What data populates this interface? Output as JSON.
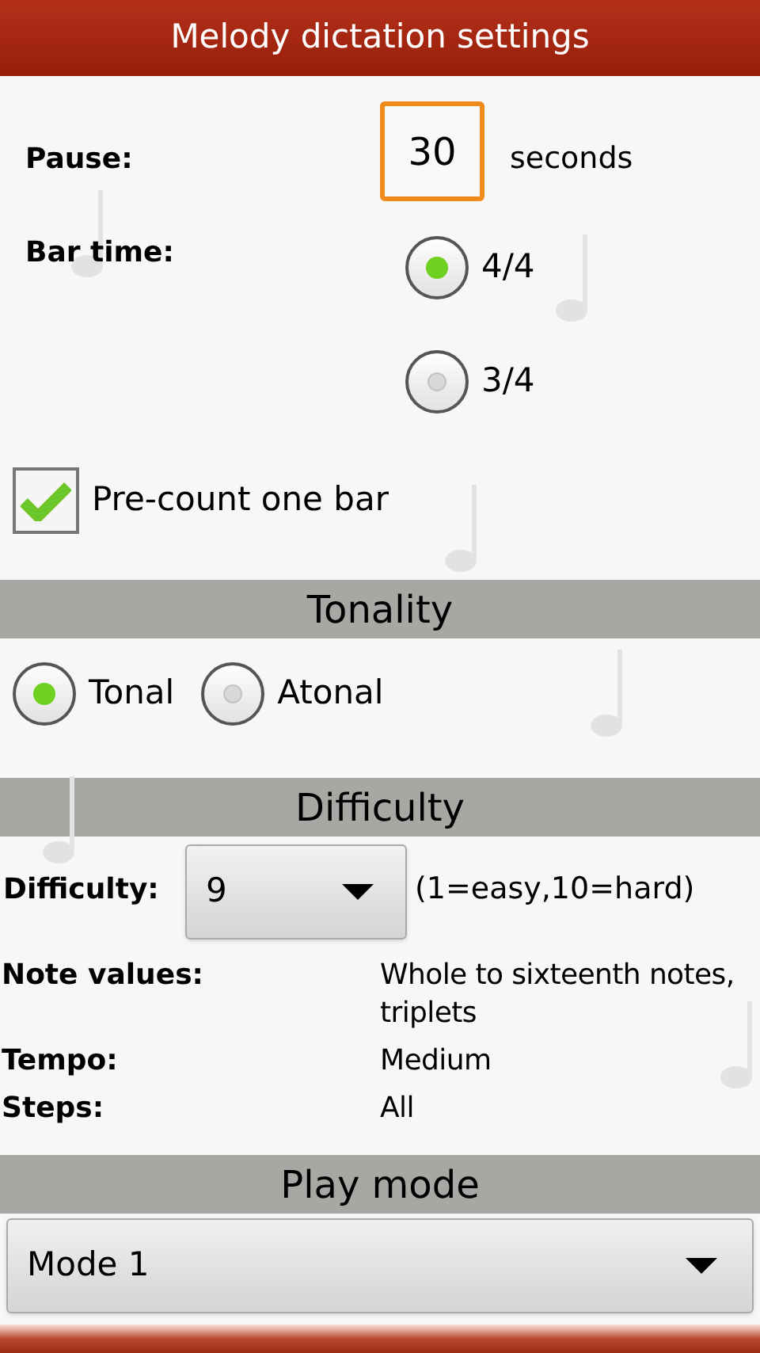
{
  "window": {
    "title": "Melody dictation settings"
  },
  "pause": {
    "label": "Pause:",
    "value": "30",
    "unit": "seconds"
  },
  "bar_time": {
    "label": "Bar time:",
    "options": [
      {
        "label": "4/4",
        "selected": true
      },
      {
        "label": "3/4",
        "selected": false
      }
    ]
  },
  "pre_count": {
    "label": "Pre-count one bar",
    "checked": true
  },
  "tonality": {
    "heading": "Tonality",
    "options": [
      {
        "label": "Tonal",
        "selected": true
      },
      {
        "label": "Atonal",
        "selected": false
      }
    ]
  },
  "difficulty": {
    "heading": "Difficulty",
    "label": "Difficulty:",
    "value": "9",
    "hint": "(1=easy,10=hard)",
    "details": [
      {
        "label": "Note values:",
        "value": "Whole to sixteenth notes, triplets"
      },
      {
        "label": "Tempo:",
        "value": "Medium"
      },
      {
        "label": "Steps:",
        "value": "All"
      }
    ]
  },
  "play_mode": {
    "heading": "Play mode",
    "value": "Mode 1"
  }
}
